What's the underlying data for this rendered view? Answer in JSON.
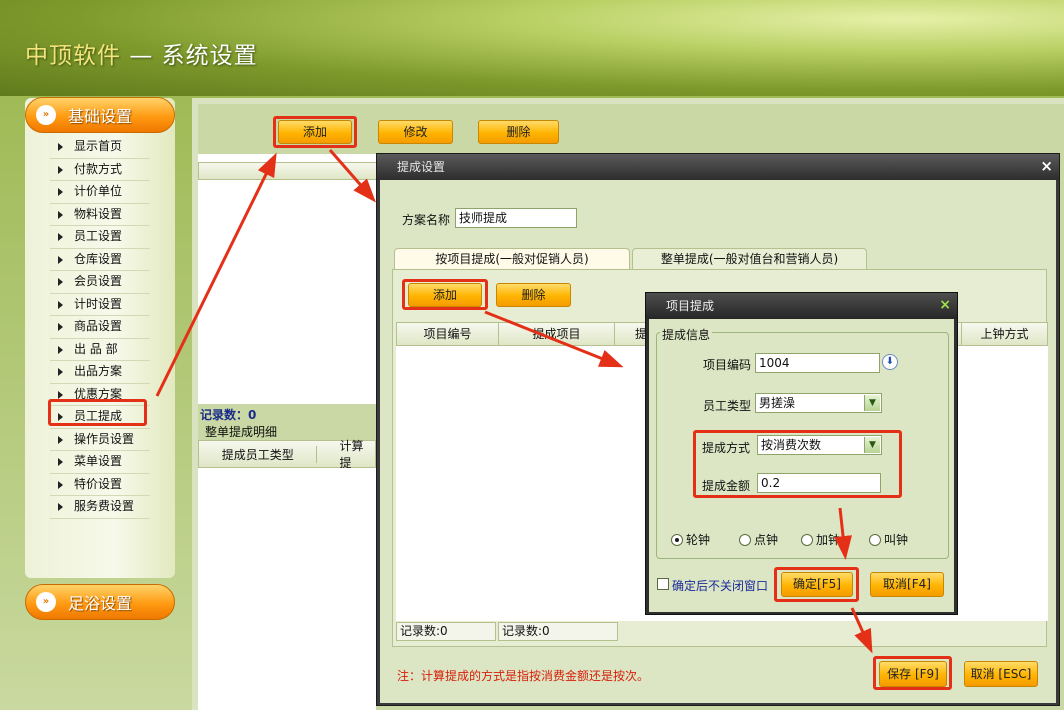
{
  "header": {
    "brand": "中顶软件",
    "separator": "—",
    "title": "系统设置"
  },
  "sidebar": {
    "basic_label": "基础设置",
    "bath_label": "足浴设置",
    "items": [
      "显示首页",
      "付款方式",
      "计价单位",
      "物料设置",
      "员工设置",
      "仓库设置",
      "会员设置",
      "计时设置",
      "商品设置",
      "出 品 部",
      "出品方案",
      "优惠方案",
      "员工提成",
      "操作员设置",
      "菜单设置",
      "特价设置",
      "服务费设置"
    ],
    "selected": "员工提成"
  },
  "main": {
    "add_label": "添加",
    "edit_label": "修改",
    "delete_label": "删除",
    "record_count": "记录数：0",
    "detail_title": "整单提成明细",
    "detail_columns": [
      "提成员工类型",
      "计算提"
    ]
  },
  "dialog1": {
    "title": "提成设置",
    "close": "×",
    "scheme_label": "方案名称",
    "scheme_value": "技师提成",
    "tabs": [
      "按项目提成(一般对促销人员)",
      "整单提成(一般对值台和营销人员)"
    ],
    "add_label": "添加",
    "delete_label": "删除",
    "columns": [
      "项目编号",
      "提成项目",
      "提",
      "上钟方式"
    ],
    "status": [
      "记录数:0",
      "记录数:0"
    ],
    "note": "注：计算提成的方式是指按消费金额还是按次。",
    "save_label": "保存 [F9]",
    "cancel_label": "取消 [ESC]"
  },
  "dialog2": {
    "title": "项目提成",
    "close": "×",
    "group_label": "提成信息",
    "code_label": "项目编码",
    "code_value": "1004",
    "type_label": "员工类型",
    "type_value": "男搓澡",
    "method_label": "提成方式",
    "method_value": "按消费次数",
    "amount_label": "提成金额",
    "amount_value": "0.2",
    "radios": [
      "轮钟",
      "点钟",
      "加钟",
      "叫钟"
    ],
    "radio_selected": 0,
    "keep_open_label": "确定后不关闭窗口",
    "ok_label": "确定[F5]",
    "cancel_label": "取消[F4]"
  },
  "colors": {
    "accent_orange": "#ffb400",
    "annotation_red": "#e53018",
    "dialog_dark": "#2f2f2f"
  }
}
